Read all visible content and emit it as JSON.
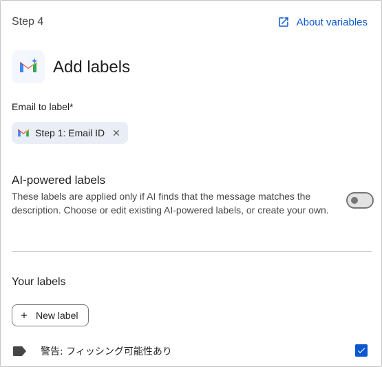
{
  "header": {
    "step_label": "Step 4",
    "about_link": "About variables",
    "link_color": "#0b57d0"
  },
  "action": {
    "icon": "gmail-icon",
    "title": "Add labels"
  },
  "email_field": {
    "label": "Email to label*",
    "chip_icon": "gmail-icon",
    "chip_value": "Step 1: Email ID"
  },
  "ai_labels": {
    "title": "AI-powered labels",
    "description": "These labels are applied only if AI finds that the message matches the description. Choose or edit existing AI-powered labels, or create your own.",
    "toggle_on": false
  },
  "your_labels": {
    "title": "Your labels",
    "new_button": "New label",
    "items": [
      {
        "icon": "label-tag-icon",
        "name": "警告: フィッシング可能性あり",
        "checked": true
      }
    ]
  }
}
